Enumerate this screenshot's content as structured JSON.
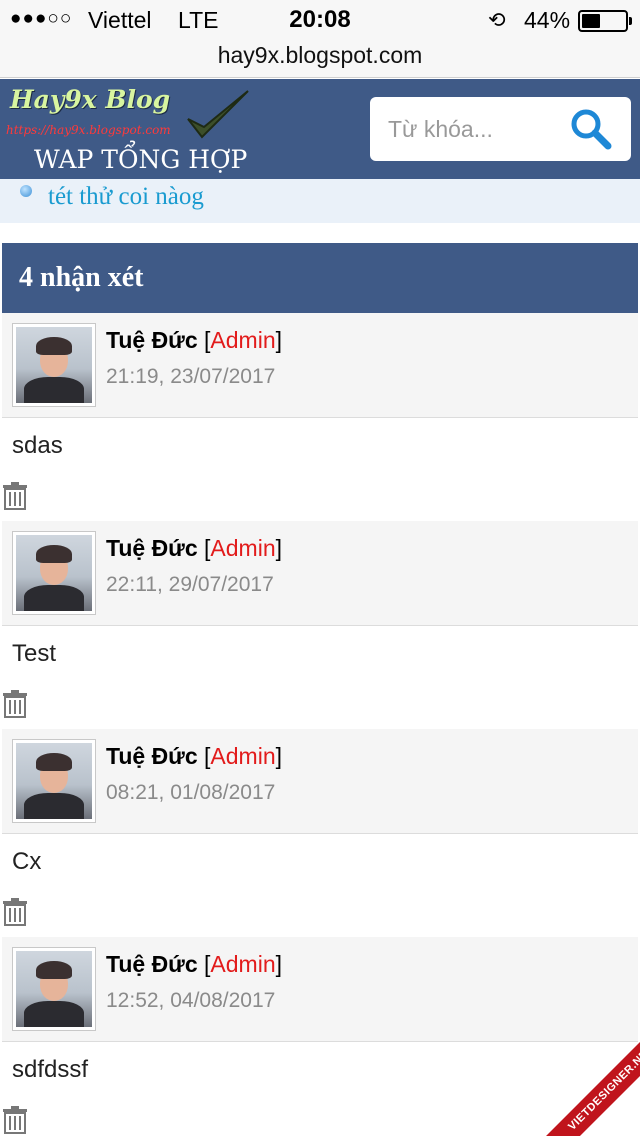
{
  "status_bar": {
    "signal": "●●●○○",
    "carrier": "Viettel",
    "network": "LTE",
    "time": "20:08",
    "battery_percent": "44%",
    "battery_level": 0.44
  },
  "url_bar": {
    "url": "hay9x.blogspot.com"
  },
  "header": {
    "logo_name": "Hay9x Blog",
    "logo_url": "https://hay9x.blogspot.com",
    "logo_tagline": "WAP TỔNG HỢP",
    "search_placeholder": "Từ khóa...",
    "brand_color": "#3f5a87",
    "search_icon": "search-icon"
  },
  "notice": {
    "text": "tét thử coi nàog"
  },
  "comments": {
    "title": "4 nhận xét",
    "items": [
      {
        "author": "Tuệ Đức",
        "role": "Admin",
        "time": "21:19, 23/07/2017",
        "text": "sdas"
      },
      {
        "author": "Tuệ Đức",
        "role": "Admin",
        "time": "22:11, 29/07/2017",
        "text": "Test"
      },
      {
        "author": "Tuệ Đức",
        "role": "Admin",
        "time": "08:21, 01/08/2017",
        "text": "Cx"
      },
      {
        "author": "Tuệ Đức",
        "role": "Admin",
        "time": "12:52, 04/08/2017",
        "text": "sdfdssf"
      }
    ],
    "role_color": "#e21b1b",
    "delete_icon": "trash-icon"
  },
  "watermark": {
    "text": "VIETDESIGNER.NET"
  }
}
